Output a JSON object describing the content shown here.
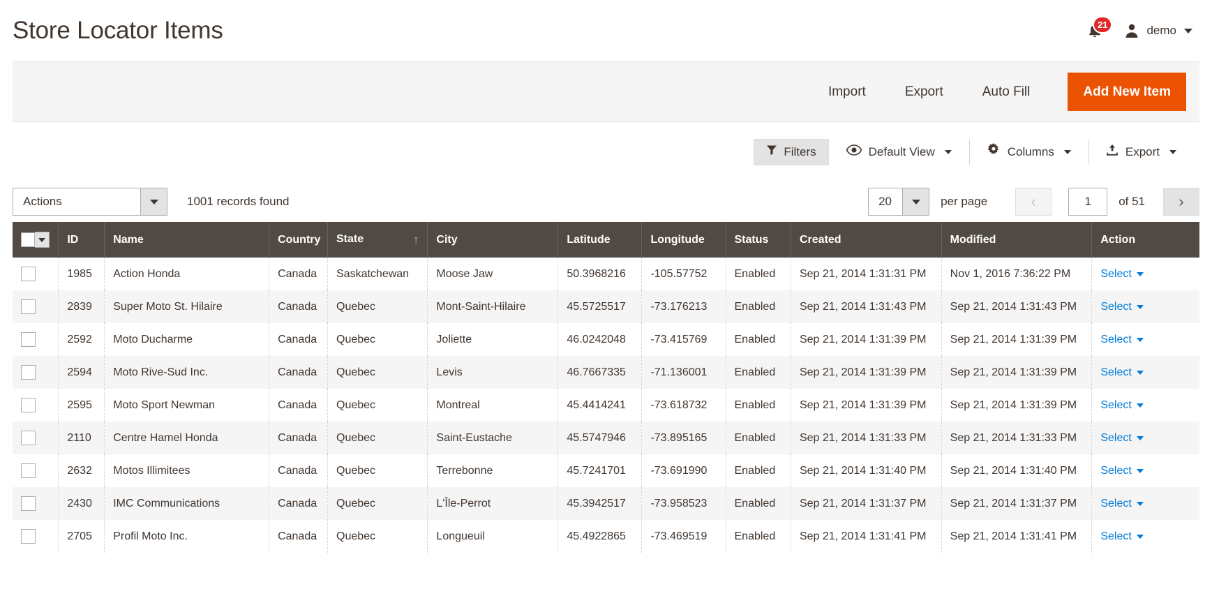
{
  "header": {
    "title": "Store Locator Items",
    "notifications_count": "21",
    "user_name": "demo",
    "bell_icon": "bell-icon",
    "avatar_icon": "user-avatar-icon",
    "caret_icon": "chevron-down-icon"
  },
  "action_bar": {
    "import_label": "Import",
    "export_label": "Export",
    "autofill_label": "Auto Fill",
    "add_new_label": "Add New Item",
    "primary_color": "#eb5202"
  },
  "grid_toolbar": {
    "filters_label": "Filters",
    "filters_icon": "funnel-icon",
    "view_label": "Default View",
    "view_icon": "eye-icon",
    "columns_label": "Columns",
    "columns_icon": "gear-icon",
    "export_label": "Export",
    "export_icon": "upload-icon"
  },
  "controls": {
    "actions_label": "Actions",
    "records_found": "1001 records found",
    "per_page_value": "20",
    "per_page_label": "per page",
    "prev_icon": "chevron-left-icon",
    "next_icon": "chevron-right-icon",
    "current_page": "1",
    "total_pages_label": "of 51"
  },
  "table": {
    "columns": [
      {
        "label": "",
        "name": "select-all"
      },
      {
        "label": "ID",
        "name": "id"
      },
      {
        "label": "Name",
        "name": "name"
      },
      {
        "label": "Country",
        "name": "country"
      },
      {
        "label": "State",
        "name": "state"
      },
      {
        "label": "City",
        "name": "city"
      },
      {
        "label": "Latitude",
        "name": "latitude"
      },
      {
        "label": "Longitude",
        "name": "longitude"
      },
      {
        "label": "Status",
        "name": "status"
      },
      {
        "label": "Created",
        "name": "created"
      },
      {
        "label": "Modified",
        "name": "modified"
      },
      {
        "label": "Action",
        "name": "action"
      }
    ],
    "sorted_column": "State",
    "sort_direction": "↑",
    "action_link_label": "Select",
    "rows": [
      {
        "id": "1985",
        "name": "Action Honda",
        "country": "Canada",
        "state": "Saskatchewan",
        "city": "Moose Jaw",
        "latitude": "50.3968216",
        "longitude": "-105.57752",
        "status": "Enabled",
        "created": "Sep 21, 2014 1:31:31 PM",
        "modified": "Nov 1, 2016 7:36:22 PM"
      },
      {
        "id": "2839",
        "name": "Super Moto St. Hilaire",
        "country": "Canada",
        "state": "Quebec",
        "city": "Mont-Saint-Hilaire",
        "latitude": "45.5725517",
        "longitude": "-73.176213",
        "status": "Enabled",
        "created": "Sep 21, 2014 1:31:43 PM",
        "modified": "Sep 21, 2014 1:31:43 PM"
      },
      {
        "id": "2592",
        "name": "Moto Ducharme",
        "country": "Canada",
        "state": "Quebec",
        "city": "Joliette",
        "latitude": "46.0242048",
        "longitude": "-73.415769",
        "status": "Enabled",
        "created": "Sep 21, 2014 1:31:39 PM",
        "modified": "Sep 21, 2014 1:31:39 PM"
      },
      {
        "id": "2594",
        "name": "Moto Rive-Sud Inc.",
        "country": "Canada",
        "state": "Quebec",
        "city": "Levis",
        "latitude": "46.7667335",
        "longitude": "-71.136001",
        "status": "Enabled",
        "created": "Sep 21, 2014 1:31:39 PM",
        "modified": "Sep 21, 2014 1:31:39 PM"
      },
      {
        "id": "2595",
        "name": "Moto Sport Newman",
        "country": "Canada",
        "state": "Quebec",
        "city": "Montreal",
        "latitude": "45.4414241",
        "longitude": "-73.618732",
        "status": "Enabled",
        "created": "Sep 21, 2014 1:31:39 PM",
        "modified": "Sep 21, 2014 1:31:39 PM"
      },
      {
        "id": "2110",
        "name": "Centre Hamel Honda",
        "country": "Canada",
        "state": "Quebec",
        "city": "Saint-Eustache",
        "latitude": "45.5747946",
        "longitude": "-73.895165",
        "status": "Enabled",
        "created": "Sep 21, 2014 1:31:33 PM",
        "modified": "Sep 21, 2014 1:31:33 PM"
      },
      {
        "id": "2632",
        "name": "Motos Illimitees",
        "country": "Canada",
        "state": "Quebec",
        "city": "Terrebonne",
        "latitude": "45.7241701",
        "longitude": "-73.691990",
        "status": "Enabled",
        "created": "Sep 21, 2014 1:31:40 PM",
        "modified": "Sep 21, 2014 1:31:40 PM"
      },
      {
        "id": "2430",
        "name": "IMC Communications",
        "country": "Canada",
        "state": "Quebec",
        "city": "L'Île-Perrot",
        "latitude": "45.3942517",
        "longitude": "-73.958523",
        "status": "Enabled",
        "created": "Sep 21, 2014 1:31:37 PM",
        "modified": "Sep 21, 2014 1:31:37 PM"
      },
      {
        "id": "2705",
        "name": "Profil Moto Inc.",
        "country": "Canada",
        "state": "Quebec",
        "city": "Longueuil",
        "latitude": "45.4922865",
        "longitude": "-73.469519",
        "status": "Enabled",
        "created": "Sep 21, 2014 1:31:41 PM",
        "modified": "Sep 21, 2014 1:31:41 PM"
      }
    ]
  }
}
